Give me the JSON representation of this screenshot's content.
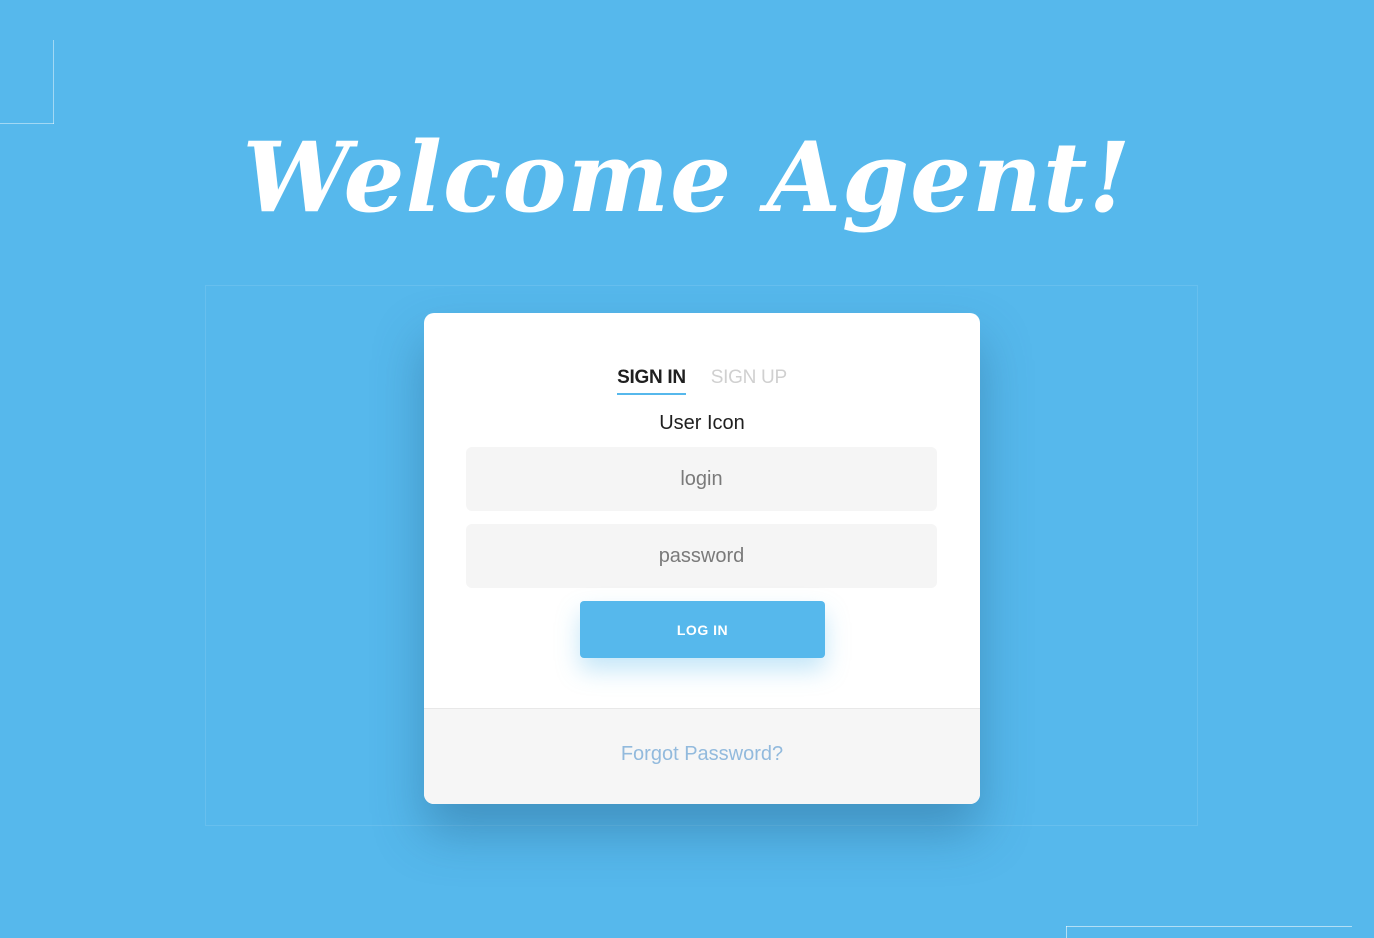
{
  "heading": "Welcome Agent!",
  "tabs": [
    {
      "label": "SIGN IN",
      "active": true
    },
    {
      "label": "SIGN UP",
      "active": false
    }
  ],
  "user_icon_label": "User Icon",
  "form": {
    "login_placeholder": "login",
    "password_placeholder": "password",
    "submit_label": "LOG IN"
  },
  "footer": {
    "forgot_label": "Forgot Password?"
  },
  "colors": {
    "background": "#56b8ec",
    "accent": "#56b8ec",
    "card": "#ffffff",
    "link": "#92badd"
  }
}
